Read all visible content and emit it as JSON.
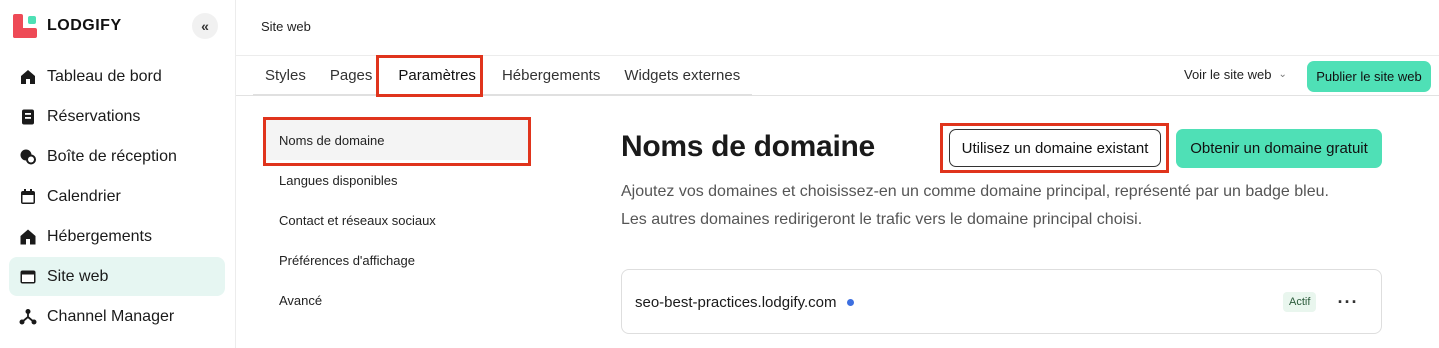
{
  "brand": {
    "name": "LODGIFY"
  },
  "sidebar": {
    "collapse_glyph": "«",
    "items": [
      {
        "label": "Tableau de bord",
        "icon": "dashboard-icon"
      },
      {
        "label": "Réservations",
        "icon": "reservations-icon"
      },
      {
        "label": "Boîte de réception",
        "icon": "inbox-icon"
      },
      {
        "label": "Calendrier",
        "icon": "calendar-icon"
      },
      {
        "label": "Hébergements",
        "icon": "home-icon"
      },
      {
        "label": "Site web",
        "icon": "website-icon",
        "active": true
      },
      {
        "label": "Channel Manager",
        "icon": "channel-manager-icon"
      }
    ]
  },
  "header": {
    "breadcrumb": "Site web"
  },
  "tabs": [
    {
      "label": "Styles"
    },
    {
      "label": "Pages"
    },
    {
      "label": "Paramètres",
      "active": true
    },
    {
      "label": "Hébergements"
    },
    {
      "label": "Widgets externes"
    }
  ],
  "topright": {
    "view_site": "Voir le site web",
    "publish": "Publier le site web"
  },
  "settings_nav": [
    {
      "label": "Noms de domaine",
      "active": true
    },
    {
      "label": "Langues disponibles"
    },
    {
      "label": "Contact et réseaux sociaux"
    },
    {
      "label": "Préférences d'affichage"
    },
    {
      "label": "Avancé"
    }
  ],
  "main": {
    "title": "Noms de domaine",
    "btn_existing": "Utilisez un domaine existant",
    "btn_free": "Obtenir un domaine gratuit",
    "desc_line1": "Ajoutez vos domaines et choisissez-en un comme domaine principal, représenté par un badge bleu.",
    "desc_line2": "Les autres domaines redirigeront le trafic vers le domaine principal choisi.",
    "domain": {
      "name": "seo-best-practices.lodgify.com",
      "status": "Actif",
      "more": "···"
    }
  },
  "colors": {
    "accent": "#4fe0b6",
    "highlight": "#e0341c",
    "brand_red": "#ee4a56",
    "primary_dot": "#3d6fe0"
  }
}
